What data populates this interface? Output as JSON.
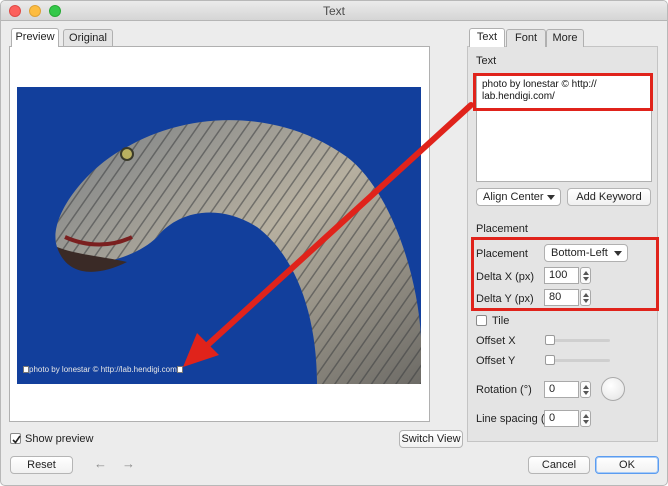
{
  "window": {
    "title": "Text"
  },
  "left_tabs": [
    {
      "label": "Preview",
      "active": true
    },
    {
      "label": "Original",
      "active": false
    }
  ],
  "preview": {
    "watermark_text": "photo by lonestar © http://lab.hendigi.com",
    "show_preview_label": "Show preview",
    "show_preview_checked": true,
    "switch_view_label": "Switch View"
  },
  "right_tabs": [
    {
      "label": "Text",
      "active": true
    },
    {
      "label": "Font",
      "active": false
    },
    {
      "label": "More",
      "active": false
    }
  ],
  "text_section": {
    "label": "Text",
    "content": "photo by lonestar © http://\nlab.hendigi.com/",
    "align_label": "Align Center",
    "add_keyword_label": "Add Keyword"
  },
  "placement_section": {
    "label": "Placement",
    "placement_label": "Placement",
    "placement_value": "Bottom-Left",
    "delta_x_label": "Delta X (px)",
    "delta_x_value": "100",
    "delta_y_label": "Delta Y (px)",
    "delta_y_value": "80",
    "tile_label": "Tile",
    "offset_x_label": "Offset X",
    "offset_y_label": "Offset Y",
    "rotation_label": "Rotation (°)",
    "rotation_value": "0",
    "line_spacing_label": "Line spacing (p",
    "line_spacing_value": "0"
  },
  "footer": {
    "reset_label": "Reset",
    "undo_icon": "←",
    "redo_icon": "→",
    "cancel_label": "Cancel",
    "ok_label": "OK"
  },
  "colors": {
    "annotation_red": "#e0231b",
    "photo_sky_blue": "#123f9c",
    "default_button_blue": "#5b9cf0"
  }
}
